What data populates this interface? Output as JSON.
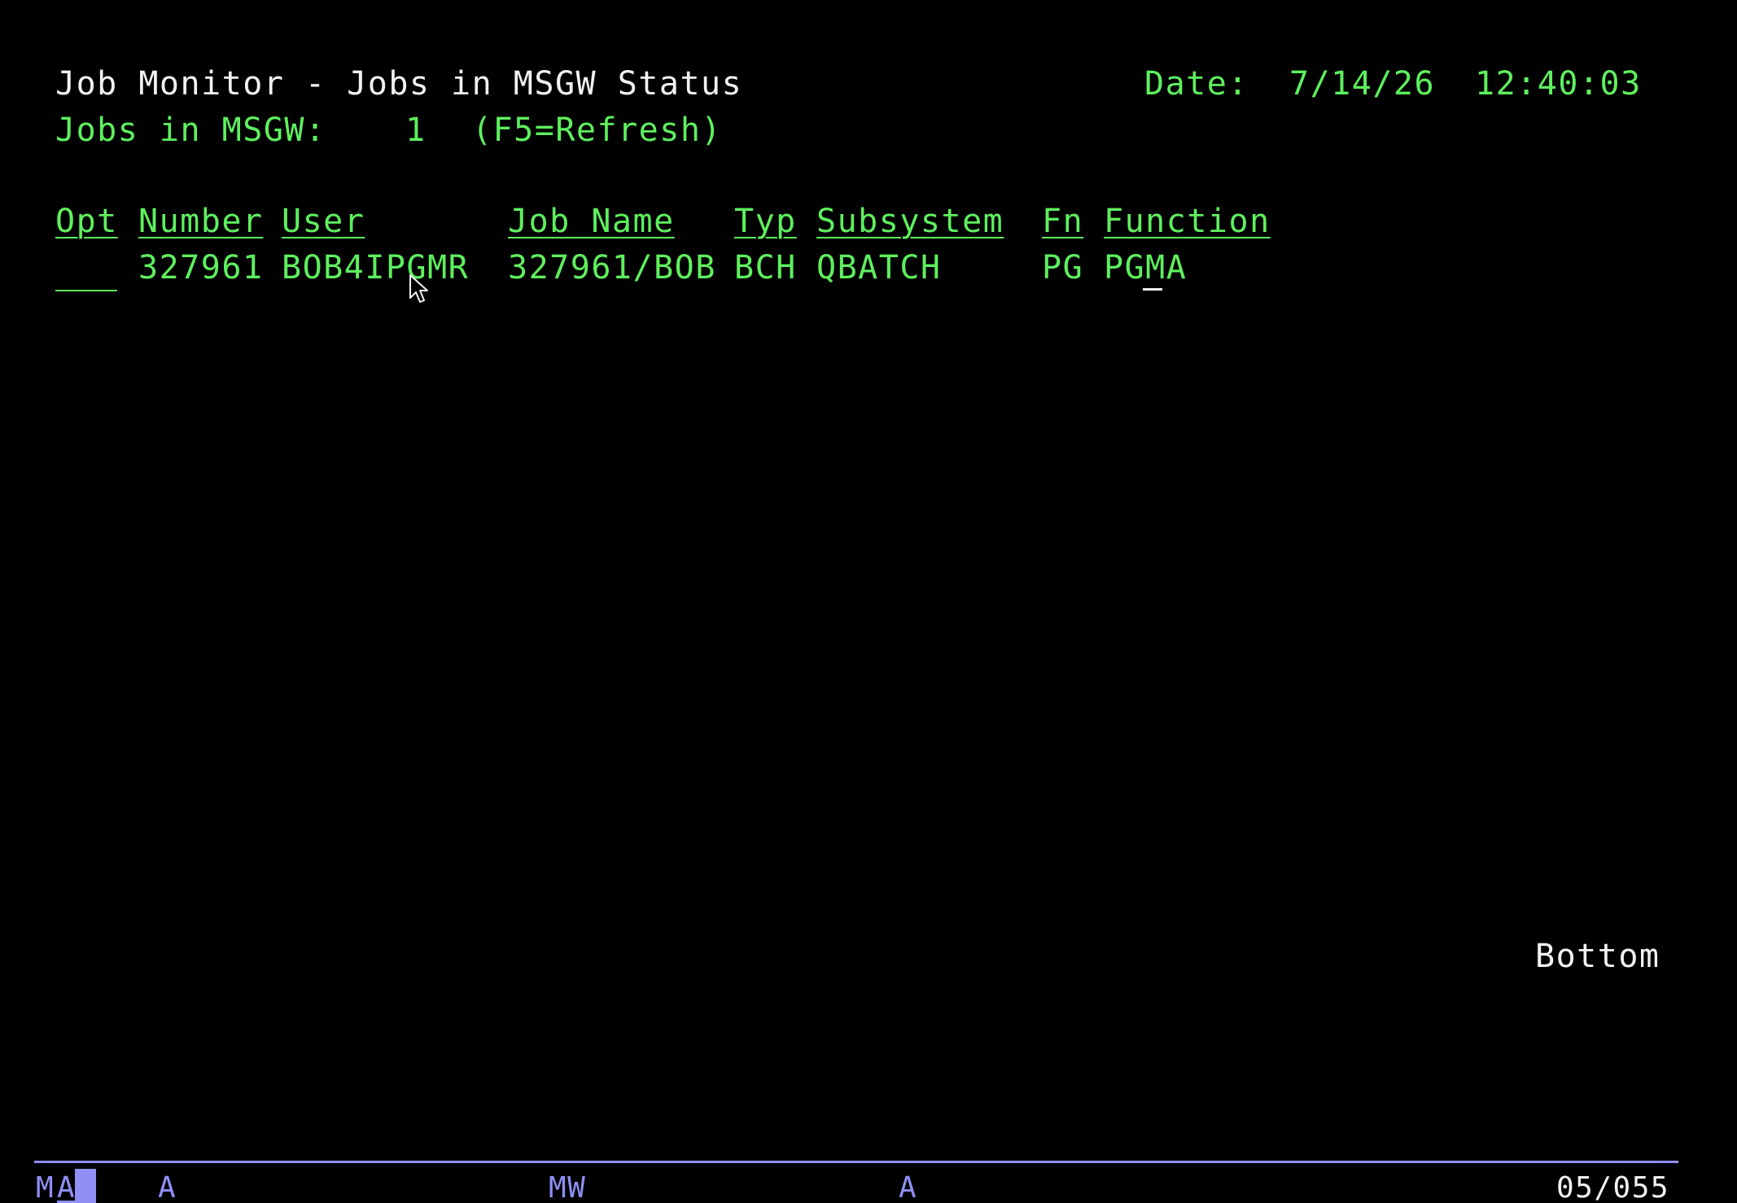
{
  "header": {
    "title": "Job Monitor - Jobs in MSGW Status",
    "date_label": "Date:",
    "date_value": "7/14/26",
    "time_value": "12:40:03",
    "count_label": "Jobs in MSGW:",
    "count_value": "1",
    "refresh_hint": "(F5=Refresh)"
  },
  "table": {
    "columns": [
      "Opt",
      "Number",
      "User",
      "Job Name",
      "Typ",
      "Subsystem",
      "Fn",
      "Function"
    ],
    "rows": [
      {
        "opt": "",
        "number": "327961",
        "user": "BOB4IPGMR",
        "job_name": "327961/BOB",
        "typ": "BCH",
        "subsystem": "QBATCH",
        "fn": "PG",
        "function": "PGMA"
      }
    ]
  },
  "footer": {
    "list_position": "Bottom"
  },
  "status_bar": {
    "mode_prefix": "M",
    "mode_indicator": "A",
    "session_a": "A",
    "message_waiting": "MW",
    "session_a2": "A",
    "cursor_position": "05/055"
  },
  "colors": {
    "background": "#000000",
    "field_green": "#5ef05e",
    "text_white": "#f2f2f2",
    "oia_blue": "#8f8ff5"
  }
}
